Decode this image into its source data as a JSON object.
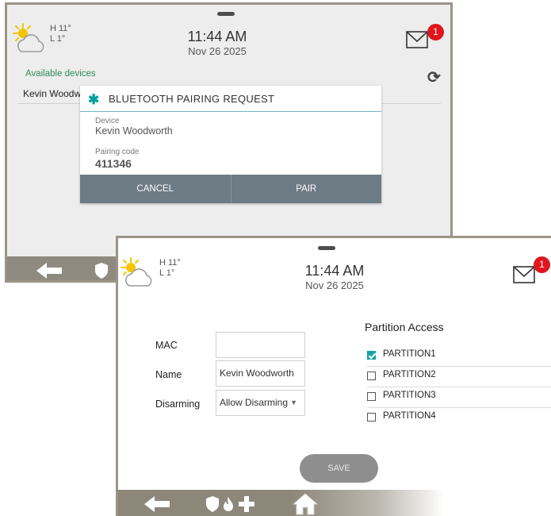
{
  "panel1": {
    "weather": {
      "high": "H 11°",
      "low": "L 1°",
      "icon": "partly-cloudy-icon"
    },
    "time": "11:44 AM",
    "date": "Nov 26 2025",
    "messages_badge": "1",
    "available_devices_label": "Available devices",
    "device_row_text": "Kevin Woodw",
    "dialog": {
      "title": "BLUETOOTH PAIRING REQUEST",
      "device_label": "Device",
      "device_value": "Kevin Woodworth",
      "pairing_label": "Pairing code",
      "pairing_code": "411346",
      "cancel_label": "CANCEL",
      "pair_label": "PAIR"
    }
  },
  "panel2": {
    "weather": {
      "high": "H 11°",
      "low": "L 1°",
      "icon": "partly-cloudy-icon"
    },
    "time": "11:44 AM",
    "date": "Nov 26 2025",
    "messages_badge": "1",
    "form": {
      "mac_label": "MAC",
      "mac_value": "",
      "name_label": "Name",
      "name_value": "Kevin Woodworth",
      "disarming_label": "Disarming",
      "disarming_value": "Allow Disarming"
    },
    "partition_access": {
      "title": "Partition Access",
      "items": [
        {
          "label": "PARTITION1",
          "checked": true
        },
        {
          "label": "PARTITION2",
          "checked": false
        },
        {
          "label": "PARTITION3",
          "checked": false
        },
        {
          "label": "PARTITION4",
          "checked": false
        }
      ]
    },
    "save_label": "SAVE"
  },
  "colors": {
    "accent_teal": "#1aa0a0",
    "badge_red": "#e0161e",
    "dialog_actions": "#6d7b85",
    "frame": "#9a9488",
    "available_green": "#2e8b57"
  }
}
